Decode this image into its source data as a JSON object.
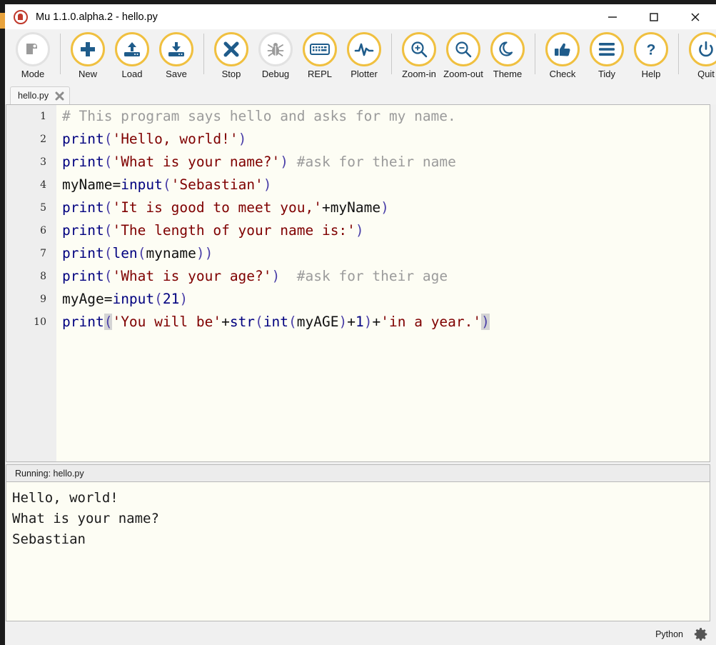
{
  "window": {
    "title": "Mu 1.1.0.alpha.2 - hello.py",
    "app_icon": "mu-logo-icon",
    "controls": {
      "minimize": "minimize-icon",
      "maximize": "maximize-icon",
      "close": "close-icon"
    }
  },
  "toolbar": {
    "accent_color": "#f0c040",
    "icon_color": "#1f5c8b",
    "disabled_color": "#9a9a9a",
    "items": [
      {
        "label": "Mode",
        "icon": "mode-icon",
        "enabled": false
      },
      {
        "label": "New",
        "icon": "new-icon",
        "enabled": true
      },
      {
        "label": "Load",
        "icon": "load-icon",
        "enabled": true
      },
      {
        "label": "Save",
        "icon": "save-icon",
        "enabled": true
      },
      {
        "label": "Stop",
        "icon": "stop-icon",
        "enabled": true
      },
      {
        "label": "Debug",
        "icon": "debug-icon",
        "enabled": false
      },
      {
        "label": "REPL",
        "icon": "repl-icon",
        "enabled": true
      },
      {
        "label": "Plotter",
        "icon": "plotter-icon",
        "enabled": true
      },
      {
        "label": "Zoom-in",
        "icon": "zoom-in-icon",
        "enabled": true
      },
      {
        "label": "Zoom-out",
        "icon": "zoom-out-icon",
        "enabled": true
      },
      {
        "label": "Theme",
        "icon": "theme-icon",
        "enabled": true
      },
      {
        "label": "Check",
        "icon": "check-icon",
        "enabled": true
      },
      {
        "label": "Tidy",
        "icon": "tidy-icon",
        "enabled": true
      },
      {
        "label": "Help",
        "icon": "help-icon",
        "enabled": true
      },
      {
        "label": "Quit",
        "icon": "quit-icon",
        "enabled": true
      }
    ]
  },
  "tabs": [
    {
      "label": "hello.py",
      "close_icon": "close-icon",
      "active": true
    }
  ],
  "editor": {
    "line_numbers": [
      "1",
      "2",
      "3",
      "4",
      "5",
      "6",
      "7",
      "8",
      "9",
      "10"
    ],
    "lines": [
      [
        {
          "t": "# This program says hello and asks for my name.",
          "c": "comment"
        }
      ],
      [
        {
          "t": "print",
          "c": "kw"
        },
        {
          "t": "(",
          "c": "paren"
        },
        {
          "t": "'Hello, world!'",
          "c": "str"
        },
        {
          "t": ")",
          "c": "paren"
        }
      ],
      [
        {
          "t": "print",
          "c": "kw"
        },
        {
          "t": "(",
          "c": "paren"
        },
        {
          "t": "'What is your name?'",
          "c": "str"
        },
        {
          "t": ")",
          "c": "paren"
        },
        {
          "t": " ",
          "c": "plain"
        },
        {
          "t": "#ask for their name",
          "c": "comment"
        }
      ],
      [
        {
          "t": "myName",
          "c": "plain"
        },
        {
          "t": "=",
          "c": "plain"
        },
        {
          "t": "input",
          "c": "kw"
        },
        {
          "t": "(",
          "c": "paren"
        },
        {
          "t": "'Sebastian'",
          "c": "str"
        },
        {
          "t": ")",
          "c": "paren"
        }
      ],
      [
        {
          "t": "print",
          "c": "kw"
        },
        {
          "t": "(",
          "c": "paren"
        },
        {
          "t": "'It is good to meet you,'",
          "c": "str"
        },
        {
          "t": "+myName",
          "c": "plain"
        },
        {
          "t": ")",
          "c": "paren"
        }
      ],
      [
        {
          "t": "print",
          "c": "kw"
        },
        {
          "t": "(",
          "c": "paren"
        },
        {
          "t": "'The length of your name is:'",
          "c": "str"
        },
        {
          "t": ")",
          "c": "paren"
        }
      ],
      [
        {
          "t": "print",
          "c": "kw"
        },
        {
          "t": "(",
          "c": "paren"
        },
        {
          "t": "len",
          "c": "kw"
        },
        {
          "t": "(",
          "c": "paren"
        },
        {
          "t": "myname",
          "c": "plain"
        },
        {
          "t": "))",
          "c": "paren"
        }
      ],
      [
        {
          "t": "print",
          "c": "kw"
        },
        {
          "t": "(",
          "c": "paren"
        },
        {
          "t": "'What is your age?'",
          "c": "str"
        },
        {
          "t": ")",
          "c": "paren"
        },
        {
          "t": "  ",
          "c": "plain"
        },
        {
          "t": "#ask for their age",
          "c": "comment"
        }
      ],
      [
        {
          "t": "myAge",
          "c": "plain"
        },
        {
          "t": "=",
          "c": "plain"
        },
        {
          "t": "input",
          "c": "kw"
        },
        {
          "t": "(",
          "c": "paren"
        },
        {
          "t": "21",
          "c": "num"
        },
        {
          "t": ")",
          "c": "paren"
        }
      ],
      [
        {
          "t": "print",
          "c": "kw"
        },
        {
          "t": "(",
          "c": "match"
        },
        {
          "t": "'You will be'",
          "c": "str"
        },
        {
          "t": "+",
          "c": "plain"
        },
        {
          "t": "str",
          "c": "kw"
        },
        {
          "t": "(",
          "c": "paren"
        },
        {
          "t": "int",
          "c": "kw"
        },
        {
          "t": "(",
          "c": "paren"
        },
        {
          "t": "myAGE",
          "c": "plain"
        },
        {
          "t": ")",
          "c": "paren"
        },
        {
          "t": "+",
          "c": "plain"
        },
        {
          "t": "1",
          "c": "num"
        },
        {
          "t": ")",
          "c": "paren"
        },
        {
          "t": "+",
          "c": "plain"
        },
        {
          "t": "'in a year.'",
          "c": "str"
        },
        {
          "t": ")",
          "c": "match"
        }
      ]
    ]
  },
  "runner": {
    "status": "Running: hello.py"
  },
  "console": {
    "lines": [
      "Hello, world!",
      "What is your name?",
      "Sebastian"
    ]
  },
  "statusbar": {
    "mode": "Python",
    "gear_icon": "gear-icon"
  }
}
